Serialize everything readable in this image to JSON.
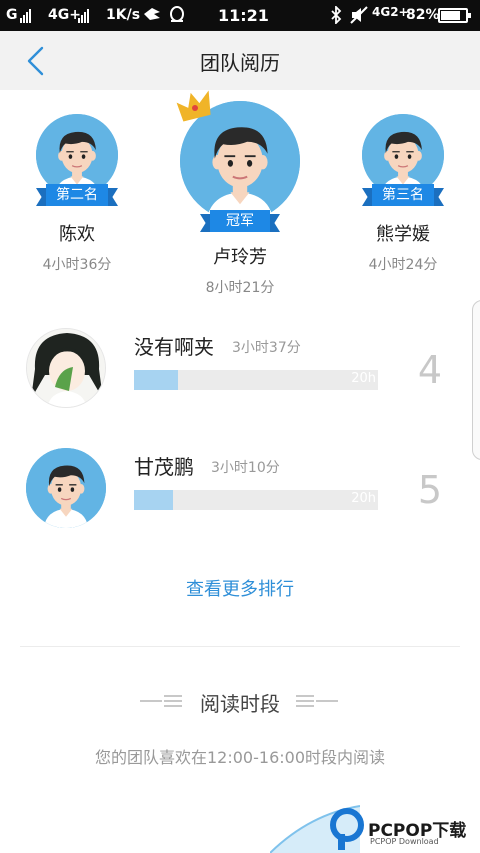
{
  "status_bar": {
    "carrier": "G",
    "network": "4G+",
    "speed": "1K/s",
    "time": "11:21",
    "network2": "4G",
    "network2_sup": "2+",
    "battery": "82%",
    "battery_level": 0.82
  },
  "header": {
    "title": "团队阅历"
  },
  "podium": {
    "second": {
      "badge": "第二名",
      "name": "陈欢",
      "time": "4小时36分"
    },
    "first": {
      "badge": "冠军",
      "name": "卢玲芳",
      "time": "8小时21分"
    },
    "third": {
      "badge": "第三名",
      "name": "熊学媛",
      "time": "4小时24分"
    }
  },
  "ranking": [
    {
      "name": "没有啊夹",
      "time": "3小时37分",
      "bar_max": "20h",
      "progress": 0.18,
      "rank": "4"
    },
    {
      "name": "甘茂鹏",
      "time": "3小时10分",
      "bar_max": "20h",
      "progress": 0.16,
      "rank": "5"
    }
  ],
  "more_link": "查看更多排行",
  "reading_period": {
    "title": "阅读时段",
    "description": "您的团队喜欢在12:00-16:00时段内阅读"
  },
  "watermark": {
    "text": "PCPOP下载",
    "sub": "PCPOP Download"
  },
  "colors": {
    "accent": "#1e88e5",
    "avatar_bg": "#62b4e4",
    "link": "#2f8fd8",
    "crown": "#f0b428"
  }
}
